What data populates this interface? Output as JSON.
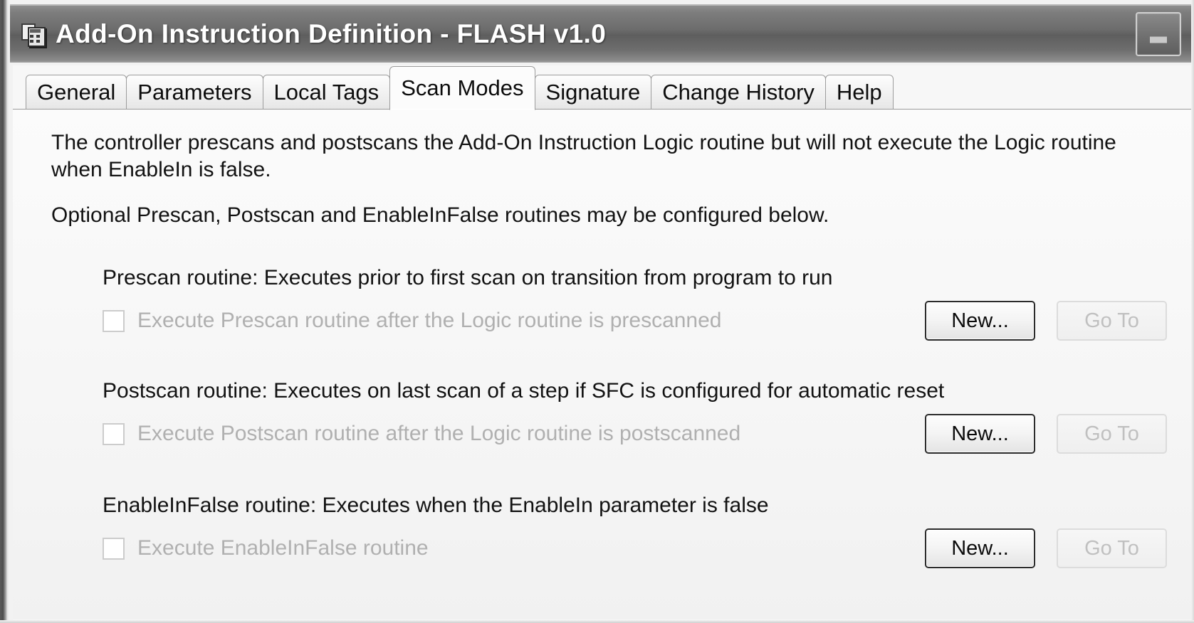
{
  "window": {
    "title": "Add-On Instruction Definition - FLASH v1.0",
    "icon": "instruction-definition-icon",
    "minimize_label": "Minimize",
    "minimize_icon": "minimize-icon"
  },
  "tabs": [
    {
      "label": "General",
      "active": false
    },
    {
      "label": "Parameters",
      "active": false
    },
    {
      "label": "Local Tags",
      "active": false
    },
    {
      "label": "Scan Modes",
      "active": true
    },
    {
      "label": "Signature",
      "active": false
    },
    {
      "label": "Change History",
      "active": false
    },
    {
      "label": "Help",
      "active": false
    }
  ],
  "page": {
    "paragraph1": "The controller prescans and postscans the Add-On Instruction Logic routine but will not execute the Logic routine when EnableIn is false.",
    "paragraph2": "Optional Prescan, Postscan and EnableInFalse routines may be configured below.",
    "sections": [
      {
        "title": "Prescan routine: Executes prior to first scan on transition from program to run",
        "checkbox_label": "Execute Prescan routine after the Logic routine is prescanned",
        "checked": false,
        "new_label": "New...",
        "goto_label": "Go To"
      },
      {
        "title": "Postscan routine: Executes on last scan of a step if SFC is configured for automatic reset",
        "checkbox_label": "Execute Postscan routine after the Logic routine is postscanned",
        "checked": false,
        "new_label": "New...",
        "goto_label": "Go To"
      },
      {
        "title": "EnableInFalse routine: Executes when the EnableIn parameter is false",
        "checkbox_label": "Execute EnableInFalse routine",
        "checked": false,
        "new_label": "New...",
        "goto_label": "Go To"
      }
    ]
  },
  "colors": {
    "titlebar_text": "#ffffff",
    "body_text": "#121212",
    "disabled_text": "#b0b0b0",
    "tab_border": "#9c9c9c",
    "default_button_border": "#2b2b2b"
  }
}
